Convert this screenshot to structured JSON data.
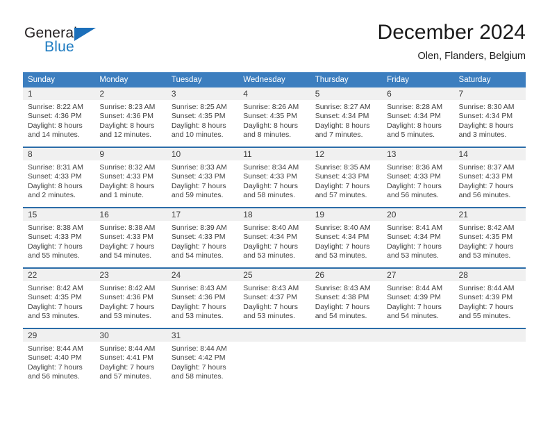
{
  "brand": {
    "name_part1": "General",
    "name_part2": "Blue",
    "triangle_icon": "triangle-logo-mark",
    "color_dark": "#231f20",
    "color_blue": "#1c7ac0"
  },
  "header": {
    "title": "December 2024",
    "subtitle": "Olen, Flanders, Belgium"
  },
  "theme": {
    "header_row_bg": "#3c7ebf",
    "header_row_text": "#ffffff",
    "daynum_band_bg": "#f0f0f0",
    "week_separator": "#2b6ca8",
    "page_bg": "#ffffff"
  },
  "calendar": {
    "weekday_headers": [
      "Sunday",
      "Monday",
      "Tuesday",
      "Wednesday",
      "Thursday",
      "Friday",
      "Saturday"
    ],
    "weeks": [
      [
        {
          "day": "1",
          "sunrise": "Sunrise: 8:22 AM",
          "sunset": "Sunset: 4:36 PM",
          "daylight_line1": "Daylight: 8 hours",
          "daylight_line2": "and 14 minutes."
        },
        {
          "day": "2",
          "sunrise": "Sunrise: 8:23 AM",
          "sunset": "Sunset: 4:36 PM",
          "daylight_line1": "Daylight: 8 hours",
          "daylight_line2": "and 12 minutes."
        },
        {
          "day": "3",
          "sunrise": "Sunrise: 8:25 AM",
          "sunset": "Sunset: 4:35 PM",
          "daylight_line1": "Daylight: 8 hours",
          "daylight_line2": "and 10 minutes."
        },
        {
          "day": "4",
          "sunrise": "Sunrise: 8:26 AM",
          "sunset": "Sunset: 4:35 PM",
          "daylight_line1": "Daylight: 8 hours",
          "daylight_line2": "and 8 minutes."
        },
        {
          "day": "5",
          "sunrise": "Sunrise: 8:27 AM",
          "sunset": "Sunset: 4:34 PM",
          "daylight_line1": "Daylight: 8 hours",
          "daylight_line2": "and 7 minutes."
        },
        {
          "day": "6",
          "sunrise": "Sunrise: 8:28 AM",
          "sunset": "Sunset: 4:34 PM",
          "daylight_line1": "Daylight: 8 hours",
          "daylight_line2": "and 5 minutes."
        },
        {
          "day": "7",
          "sunrise": "Sunrise: 8:30 AM",
          "sunset": "Sunset: 4:34 PM",
          "daylight_line1": "Daylight: 8 hours",
          "daylight_line2": "and 3 minutes."
        }
      ],
      [
        {
          "day": "8",
          "sunrise": "Sunrise: 8:31 AM",
          "sunset": "Sunset: 4:33 PM",
          "daylight_line1": "Daylight: 8 hours",
          "daylight_line2": "and 2 minutes."
        },
        {
          "day": "9",
          "sunrise": "Sunrise: 8:32 AM",
          "sunset": "Sunset: 4:33 PM",
          "daylight_line1": "Daylight: 8 hours",
          "daylight_line2": "and 1 minute."
        },
        {
          "day": "10",
          "sunrise": "Sunrise: 8:33 AM",
          "sunset": "Sunset: 4:33 PM",
          "daylight_line1": "Daylight: 7 hours",
          "daylight_line2": "and 59 minutes."
        },
        {
          "day": "11",
          "sunrise": "Sunrise: 8:34 AM",
          "sunset": "Sunset: 4:33 PM",
          "daylight_line1": "Daylight: 7 hours",
          "daylight_line2": "and 58 minutes."
        },
        {
          "day": "12",
          "sunrise": "Sunrise: 8:35 AM",
          "sunset": "Sunset: 4:33 PM",
          "daylight_line1": "Daylight: 7 hours",
          "daylight_line2": "and 57 minutes."
        },
        {
          "day": "13",
          "sunrise": "Sunrise: 8:36 AM",
          "sunset": "Sunset: 4:33 PM",
          "daylight_line1": "Daylight: 7 hours",
          "daylight_line2": "and 56 minutes."
        },
        {
          "day": "14",
          "sunrise": "Sunrise: 8:37 AM",
          "sunset": "Sunset: 4:33 PM",
          "daylight_line1": "Daylight: 7 hours",
          "daylight_line2": "and 56 minutes."
        }
      ],
      [
        {
          "day": "15",
          "sunrise": "Sunrise: 8:38 AM",
          "sunset": "Sunset: 4:33 PM",
          "daylight_line1": "Daylight: 7 hours",
          "daylight_line2": "and 55 minutes."
        },
        {
          "day": "16",
          "sunrise": "Sunrise: 8:38 AM",
          "sunset": "Sunset: 4:33 PM",
          "daylight_line1": "Daylight: 7 hours",
          "daylight_line2": "and 54 minutes."
        },
        {
          "day": "17",
          "sunrise": "Sunrise: 8:39 AM",
          "sunset": "Sunset: 4:33 PM",
          "daylight_line1": "Daylight: 7 hours",
          "daylight_line2": "and 54 minutes."
        },
        {
          "day": "18",
          "sunrise": "Sunrise: 8:40 AM",
          "sunset": "Sunset: 4:34 PM",
          "daylight_line1": "Daylight: 7 hours",
          "daylight_line2": "and 53 minutes."
        },
        {
          "day": "19",
          "sunrise": "Sunrise: 8:40 AM",
          "sunset": "Sunset: 4:34 PM",
          "daylight_line1": "Daylight: 7 hours",
          "daylight_line2": "and 53 minutes."
        },
        {
          "day": "20",
          "sunrise": "Sunrise: 8:41 AM",
          "sunset": "Sunset: 4:34 PM",
          "daylight_line1": "Daylight: 7 hours",
          "daylight_line2": "and 53 minutes."
        },
        {
          "day": "21",
          "sunrise": "Sunrise: 8:42 AM",
          "sunset": "Sunset: 4:35 PM",
          "daylight_line1": "Daylight: 7 hours",
          "daylight_line2": "and 53 minutes."
        }
      ],
      [
        {
          "day": "22",
          "sunrise": "Sunrise: 8:42 AM",
          "sunset": "Sunset: 4:35 PM",
          "daylight_line1": "Daylight: 7 hours",
          "daylight_line2": "and 53 minutes."
        },
        {
          "day": "23",
          "sunrise": "Sunrise: 8:42 AM",
          "sunset": "Sunset: 4:36 PM",
          "daylight_line1": "Daylight: 7 hours",
          "daylight_line2": "and 53 minutes."
        },
        {
          "day": "24",
          "sunrise": "Sunrise: 8:43 AM",
          "sunset": "Sunset: 4:36 PM",
          "daylight_line1": "Daylight: 7 hours",
          "daylight_line2": "and 53 minutes."
        },
        {
          "day": "25",
          "sunrise": "Sunrise: 8:43 AM",
          "sunset": "Sunset: 4:37 PM",
          "daylight_line1": "Daylight: 7 hours",
          "daylight_line2": "and 53 minutes."
        },
        {
          "day": "26",
          "sunrise": "Sunrise: 8:43 AM",
          "sunset": "Sunset: 4:38 PM",
          "daylight_line1": "Daylight: 7 hours",
          "daylight_line2": "and 54 minutes."
        },
        {
          "day": "27",
          "sunrise": "Sunrise: 8:44 AM",
          "sunset": "Sunset: 4:39 PM",
          "daylight_line1": "Daylight: 7 hours",
          "daylight_line2": "and 54 minutes."
        },
        {
          "day": "28",
          "sunrise": "Sunrise: 8:44 AM",
          "sunset": "Sunset: 4:39 PM",
          "daylight_line1": "Daylight: 7 hours",
          "daylight_line2": "and 55 minutes."
        }
      ],
      [
        {
          "day": "29",
          "sunrise": "Sunrise: 8:44 AM",
          "sunset": "Sunset: 4:40 PM",
          "daylight_line1": "Daylight: 7 hours",
          "daylight_line2": "and 56 minutes."
        },
        {
          "day": "30",
          "sunrise": "Sunrise: 8:44 AM",
          "sunset": "Sunset: 4:41 PM",
          "daylight_line1": "Daylight: 7 hours",
          "daylight_line2": "and 57 minutes."
        },
        {
          "day": "31",
          "sunrise": "Sunrise: 8:44 AM",
          "sunset": "Sunset: 4:42 PM",
          "daylight_line1": "Daylight: 7 hours",
          "daylight_line2": "and 58 minutes."
        },
        {
          "day": "",
          "sunrise": "",
          "sunset": "",
          "daylight_line1": "",
          "daylight_line2": ""
        },
        {
          "day": "",
          "sunrise": "",
          "sunset": "",
          "daylight_line1": "",
          "daylight_line2": ""
        },
        {
          "day": "",
          "sunrise": "",
          "sunset": "",
          "daylight_line1": "",
          "daylight_line2": ""
        },
        {
          "day": "",
          "sunrise": "",
          "sunset": "",
          "daylight_line1": "",
          "daylight_line2": ""
        }
      ]
    ]
  }
}
